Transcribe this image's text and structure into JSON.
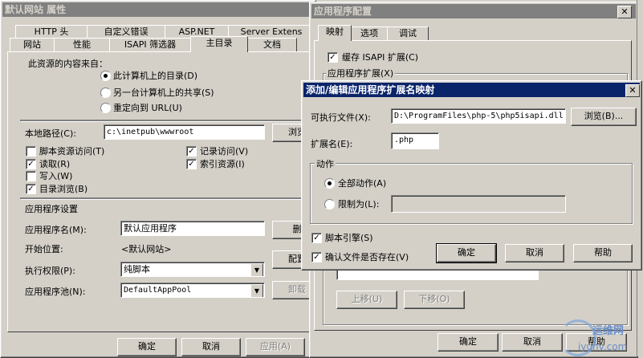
{
  "props": {
    "title": "默认网站 属性",
    "tabs_row1": [
      "HTTP 头",
      "自定义错误",
      "ASP.NET",
      "Server Extens"
    ],
    "tabs_row2": [
      "网站",
      "性能",
      "ISAPI 筛选器",
      "主目录",
      "文档"
    ],
    "source_label": "此资源的内容来自：",
    "source_options": [
      "此计算机上的目录(D)",
      "另一台计算机上的共享(S)",
      "重定向到 URL(U)"
    ],
    "local_path_label": "本地路径(C):",
    "local_path_value": "c:\\inetpub\\wwwroot",
    "browse_label": "浏览",
    "checks": {
      "script_source": "脚本资源访问(T)",
      "read": "读取(R)",
      "write": "写入(W)",
      "dir_browse": "目录浏览(B)",
      "log_visits": "记录访问(V)",
      "index_resource": "索引资源(I)"
    },
    "app_settings_label": "应用程序设置",
    "app_name_label": "应用程序名(M):",
    "app_name_value": "默认应用程序",
    "delete_label": "删",
    "start_point_label": "开始位置:",
    "start_point_value": "<默认网站>",
    "exec_perm_label": "执行权限(P):",
    "exec_perm_value": "纯脚本",
    "config_label": "配置",
    "app_pool_label": "应用程序池(N):",
    "app_pool_value": "DefaultAppPool",
    "unload_label": "卸载",
    "ok": "确定",
    "cancel": "取消",
    "apply": "应用(A)"
  },
  "appconfig": {
    "title": "应用程序配置",
    "tabs": [
      "映射",
      "选项",
      "调试"
    ],
    "cache_isapi": "缓存 ISAPI 扩展(C)",
    "app_ext_label": "应用程序扩展(X)",
    "move_up": "上移(U)",
    "move_down": "下移(O)",
    "ok": "确定",
    "cancel": "取消",
    "help": "帮助"
  },
  "extdialog": {
    "title": "添加/编辑应用程序扩展名映射",
    "exe_label": "可执行文件(X):",
    "exe_value": "D:\\ProgramFiles\\php-5\\php5isapi.dll",
    "browse": "浏览(B)...",
    "ext_label": "扩展名(E):",
    "ext_value": ".php",
    "verbs_label": "动作",
    "all_verbs": "全部动作(A)",
    "limit_to": "限制为(L):",
    "script_engine": "脚本引擎(S)",
    "verify_file": "确认文件是否存在(V)",
    "ok": "确定",
    "cancel": "取消",
    "help": "帮助"
  },
  "watermark": {
    "text1": "运维网",
    "text2": "iyunv.com"
  }
}
